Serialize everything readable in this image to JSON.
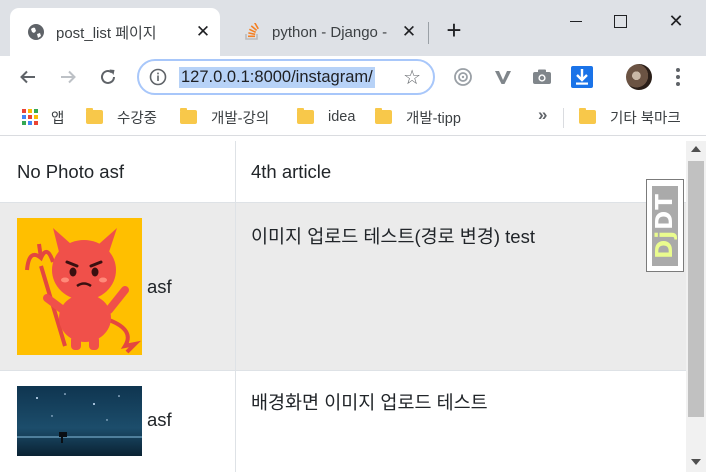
{
  "browser": {
    "tabs": [
      {
        "title": "post_list 페이지",
        "icon": "globe-icon",
        "active": true
      },
      {
        "title": "python - Django - ",
        "icon": "stackoverflow-icon",
        "active": false
      }
    ],
    "close_glyph": "✕",
    "new_tab_glyph": "+",
    "window_close_glyph": "✕",
    "address": {
      "url": "127.0.0.1:8000/instagram/",
      "selected": true
    },
    "bookmark_star_glyph": "☆",
    "extensions": [
      "target-icon",
      "vimeo-v-icon",
      "camera-icon",
      "download-icon"
    ],
    "bookmarks": {
      "apps_label": "앱",
      "items": [
        "수강중",
        "개발-강의",
        "idea",
        "개발-tipp"
      ],
      "overflow_glyph": "»",
      "other_label": "기타 북마크"
    }
  },
  "page": {
    "rows": [
      {
        "author_label": "No Photo asf",
        "message": "4th article"
      },
      {
        "author": "asf",
        "message": "이미지 업로드 테스트(경로 변경) test",
        "photo": "devil-character-image"
      },
      {
        "author": "asf",
        "message": "배경화면 이미지 업로드 테스트",
        "photo": "night-sky-image"
      }
    ],
    "debug_toolbar": {
      "prefix": "Dj",
      "suffix": "DT"
    }
  },
  "colors": {
    "tab_strip": "#dee1e6",
    "url_selection": "#b7d2f7",
    "striped_row": "#ebebeb",
    "devil_background": "#ffbf00",
    "devil_body": "#f0504a"
  }
}
